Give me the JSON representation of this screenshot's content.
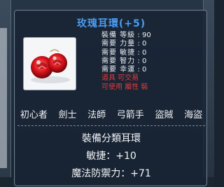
{
  "item": {
    "name": "玫瑰耳環",
    "enhance": "(+5)",
    "icon": "rose-earring-icon",
    "requirements": [
      {
        "label": "裝備 等級",
        "value": "90"
      },
      {
        "label": "需要 力量",
        "value": "0"
      },
      {
        "label": "需要 敏捷",
        "value": "0"
      },
      {
        "label": "需要 智力",
        "value": "0"
      },
      {
        "label": "需要 幸運",
        "value": "0"
      },
      {
        "label": "道具 可交易",
        "value": ""
      },
      {
        "label": "可使用 屬性 裝",
        "value": ""
      }
    ],
    "jobs": [
      "初心者",
      "劍士",
      "法師",
      "弓箭手",
      "盜賊",
      "海盜"
    ],
    "category": "裝備分類耳環",
    "dex": "敏捷：+10",
    "magic_def": "魔法防禦力：+71"
  },
  "colors": {
    "title": "#4a9cf0",
    "text": "#f2f4f6",
    "warning": "#e23a3a"
  }
}
